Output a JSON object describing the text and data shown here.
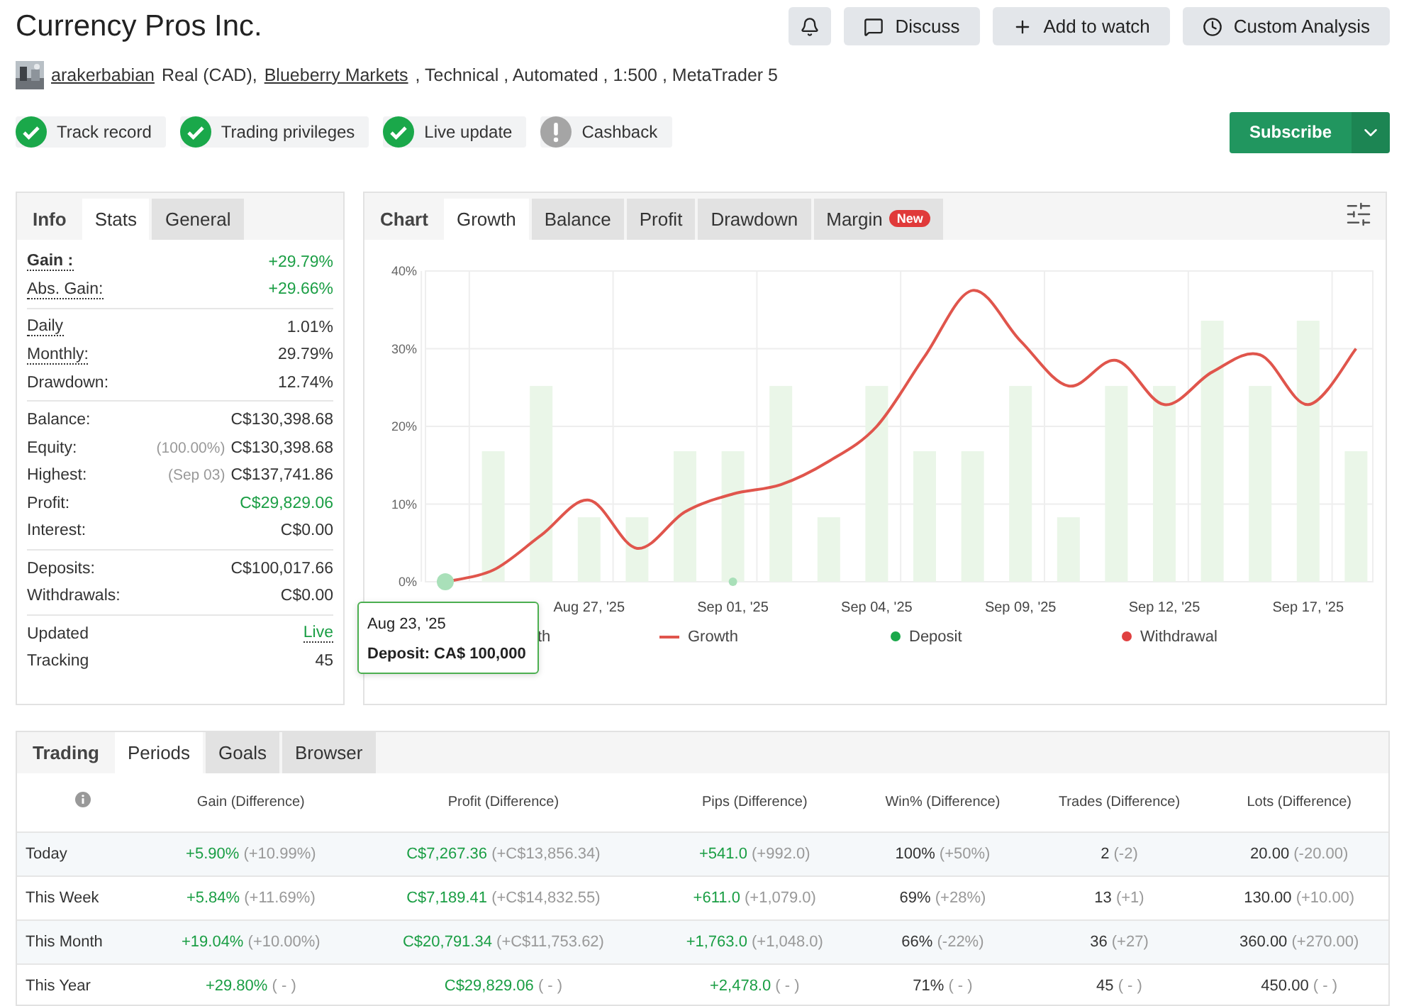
{
  "header": {
    "title": "Currency Pros Inc.",
    "actions": [
      {
        "kind": "bell"
      },
      {
        "kind": "discuss",
        "label": "Discuss"
      },
      {
        "kind": "watch",
        "label": "Add to watch"
      },
      {
        "kind": "analysis",
        "label": "Custom Analysis"
      }
    ]
  },
  "meta": [
    {
      "text": "arakerbabian",
      "link": true
    },
    {
      "text": "Real (CAD),",
      "link": false
    },
    {
      "text": "Blueberry Markets",
      "link": true
    },
    {
      "text": ", Technical , Automated , 1:500 , MetaTrader 5",
      "link": false
    }
  ],
  "badges": [
    {
      "label": "Track record",
      "verified": true
    },
    {
      "label": "Trading privileges",
      "verified": true
    },
    {
      "label": "Live update",
      "verified": true
    },
    {
      "label": "Cashback",
      "verified": false
    }
  ],
  "subscribe": {
    "label": "Subscribe"
  },
  "stats_panel": {
    "tabs": [
      {
        "label": "Info",
        "kind": "heading"
      },
      {
        "label": "Stats",
        "kind": "tab",
        "selected": true
      },
      {
        "label": "General",
        "kind": "tab",
        "selected": false
      }
    ],
    "sections": [
      [
        {
          "label": "Gain :",
          "value": "+29.79%",
          "bold": true,
          "label_dotted": true,
          "value_dotted": false,
          "positive": true
        },
        {
          "label": "Abs. Gain:",
          "value": "+29.66%",
          "bold": false,
          "label_dotted": true,
          "value_dotted": false,
          "positive": true
        }
      ],
      [
        {
          "label": "Daily",
          "value": "1.01%",
          "bold": false,
          "label_dotted": true,
          "value_dotted": false,
          "positive": false
        },
        {
          "label": "Monthly:",
          "value": "29.79%",
          "bold": false,
          "label_dotted": true,
          "value_dotted": false,
          "positive": false
        },
        {
          "label": "Drawdown:",
          "value": "12.74%",
          "bold": false,
          "label_dotted": false,
          "value_dotted": false,
          "positive": false
        }
      ],
      [
        {
          "label": "Balance:",
          "value": "C$130,398.68",
          "bold": false,
          "label_dotted": false,
          "value_dotted": false,
          "positive": false
        },
        {
          "label": "Equity:",
          "note": "(100.00%)",
          "value": "C$130,398.68",
          "bold": false,
          "label_dotted": false,
          "value_dotted": false,
          "positive": false
        },
        {
          "label": "Highest:",
          "note": "(Sep 03)",
          "value": "C$137,741.86",
          "bold": false,
          "label_dotted": false,
          "value_dotted": false,
          "positive": false
        },
        {
          "label": "Profit:",
          "value": "C$29,829.06",
          "bold": false,
          "label_dotted": false,
          "value_dotted": false,
          "positive": true
        },
        {
          "label": "Interest:",
          "value": "C$0.00",
          "bold": false,
          "label_dotted": false,
          "value_dotted": false,
          "positive": false
        }
      ],
      [
        {
          "label": "Deposits:",
          "value": "C$100,017.66",
          "bold": false,
          "label_dotted": false,
          "value_dotted": false,
          "positive": false
        },
        {
          "label": "Withdrawals:",
          "value": "C$0.00",
          "bold": false,
          "label_dotted": false,
          "value_dotted": false,
          "positive": false
        }
      ],
      [
        {
          "label": "Updated",
          "value": "Live",
          "bold": false,
          "label_dotted": false,
          "value_dotted": true,
          "positive": true
        },
        {
          "label": "Tracking",
          "value": "45",
          "bold": false,
          "label_dotted": false,
          "value_dotted": false,
          "positive": false
        }
      ]
    ]
  },
  "chart_panel": {
    "tabs": [
      {
        "label": "Chart",
        "kind": "heading"
      },
      {
        "label": "Growth",
        "kind": "tab",
        "selected": true
      },
      {
        "label": "Balance",
        "kind": "tab",
        "selected": false
      },
      {
        "label": "Profit",
        "kind": "tab",
        "selected": false
      },
      {
        "label": "Drawdown",
        "kind": "tab",
        "selected": false
      },
      {
        "label": "Margin",
        "kind": "tab",
        "selected": false,
        "badge": "New"
      }
    ],
    "chart_data": {
      "type": "line",
      "grid": true,
      "categories": [
        null,
        null,
        null,
        "Aug 27, '25",
        null,
        null,
        "Sep 01, '25",
        null,
        null,
        "Sep 04, '25",
        null,
        null,
        "Sep 09, '25",
        null,
        null,
        "Sep 12, '25",
        null,
        null,
        "Sep 17, '25",
        null
      ],
      "ylim": [
        0,
        40
      ],
      "yticks": [
        {
          "value": 0,
          "label": "0%"
        },
        {
          "value": 10,
          "label": "10%"
        },
        {
          "value": 20,
          "label": "20%"
        },
        {
          "value": 30,
          "label": "30%"
        },
        {
          "value": 40,
          "label": "40%"
        }
      ],
      "series": [
        {
          "type": "bar",
          "color": "#eaf6e8",
          "values": [
            null,
            16.8,
            25.2,
            8.3,
            8.3,
            16.8,
            16.8,
            25.2,
            8.3,
            25.2,
            16.8,
            16.8,
            25.2,
            8.3,
            25.2,
            25.2,
            33.6,
            25.2,
            33.6,
            16.8
          ]
        },
        {
          "type": "line",
          "color": "#e0554c",
          "values": [
            0,
            1.5,
            6,
            10.5,
            4.3,
            9,
            11.3,
            12.5,
            15.5,
            20,
            29,
            37.5,
            31,
            25.2,
            28.5,
            22.8,
            27,
            29.2,
            22.8,
            30
          ]
        },
        {
          "type": "scatter",
          "color": "#a9e0b9",
          "values": [
            0,
            null,
            null,
            null,
            null,
            null,
            0,
            null,
            null,
            null,
            null,
            null,
            null,
            null,
            null,
            null,
            null,
            null,
            null,
            null
          ]
        }
      ]
    },
    "legend": [
      {
        "label": "th",
        "kind": "none"
      },
      {
        "label": "Growth",
        "kind": "line",
        "color": "#e0554c"
      },
      {
        "label": "Deposit",
        "kind": "dot",
        "color": "#1aa84a"
      },
      {
        "label": "Withdrawal",
        "kind": "dot",
        "color": "#e04040"
      }
    ],
    "tooltip": {
      "date": "Aug 23, '25",
      "text": "Deposit: CA$ 100,000"
    }
  },
  "periods_panel": {
    "tabs": [
      {
        "label": "Trading",
        "kind": "heading"
      },
      {
        "label": "Periods",
        "kind": "tab",
        "selected": true
      },
      {
        "label": "Goals",
        "kind": "tab",
        "selected": false
      },
      {
        "label": "Browser",
        "kind": "tab",
        "selected": false
      }
    ],
    "columns": [
      {
        "label": "Gain (Difference)",
        "positive": true
      },
      {
        "label": "Profit (Difference)",
        "positive": true
      },
      {
        "label": "Pips (Difference)",
        "positive": true
      },
      {
        "label": "Win% (Difference)",
        "positive": false
      },
      {
        "label": "Trades (Difference)",
        "positive": false
      },
      {
        "label": "Lots (Difference)",
        "positive": false
      }
    ],
    "rows": [
      {
        "label": "Today",
        "cells": [
          [
            "+5.90%",
            "(+10.99%)"
          ],
          [
            "C$7,267.36",
            "(+C$13,856.34)"
          ],
          [
            "+541.0",
            "(+992.0)"
          ],
          [
            "100%",
            "(+50%)"
          ],
          [
            "2",
            "(-2)"
          ],
          [
            "20.00",
            "(-20.00)"
          ]
        ]
      },
      {
        "label": "This Week",
        "cells": [
          [
            "+5.84%",
            "(+11.69%)"
          ],
          [
            "C$7,189.41",
            "(+C$14,832.55)"
          ],
          [
            "+611.0",
            "(+1,079.0)"
          ],
          [
            "69%",
            "(+28%)"
          ],
          [
            "13",
            "(+1)"
          ],
          [
            "130.00",
            "(+10.00)"
          ]
        ]
      },
      {
        "label": "This Month",
        "cells": [
          [
            "+19.04%",
            "(+10.00%)"
          ],
          [
            "C$20,791.34",
            "(+C$11,753.62)"
          ],
          [
            "+1,763.0",
            "(+1,048.0)"
          ],
          [
            "66%",
            "(-22%)"
          ],
          [
            "36",
            "(+27)"
          ],
          [
            "360.00",
            "(+270.00)"
          ]
        ]
      },
      {
        "label": "This Year",
        "cells": [
          [
            "+29.80%",
            "( - )"
          ],
          [
            "C$29,829.06",
            "( - )"
          ],
          [
            "+2,478.0",
            "( - )"
          ],
          [
            "71%",
            "( - )"
          ],
          [
            "45",
            "( - )"
          ],
          [
            "450.00",
            "( - )"
          ]
        ]
      }
    ]
  }
}
